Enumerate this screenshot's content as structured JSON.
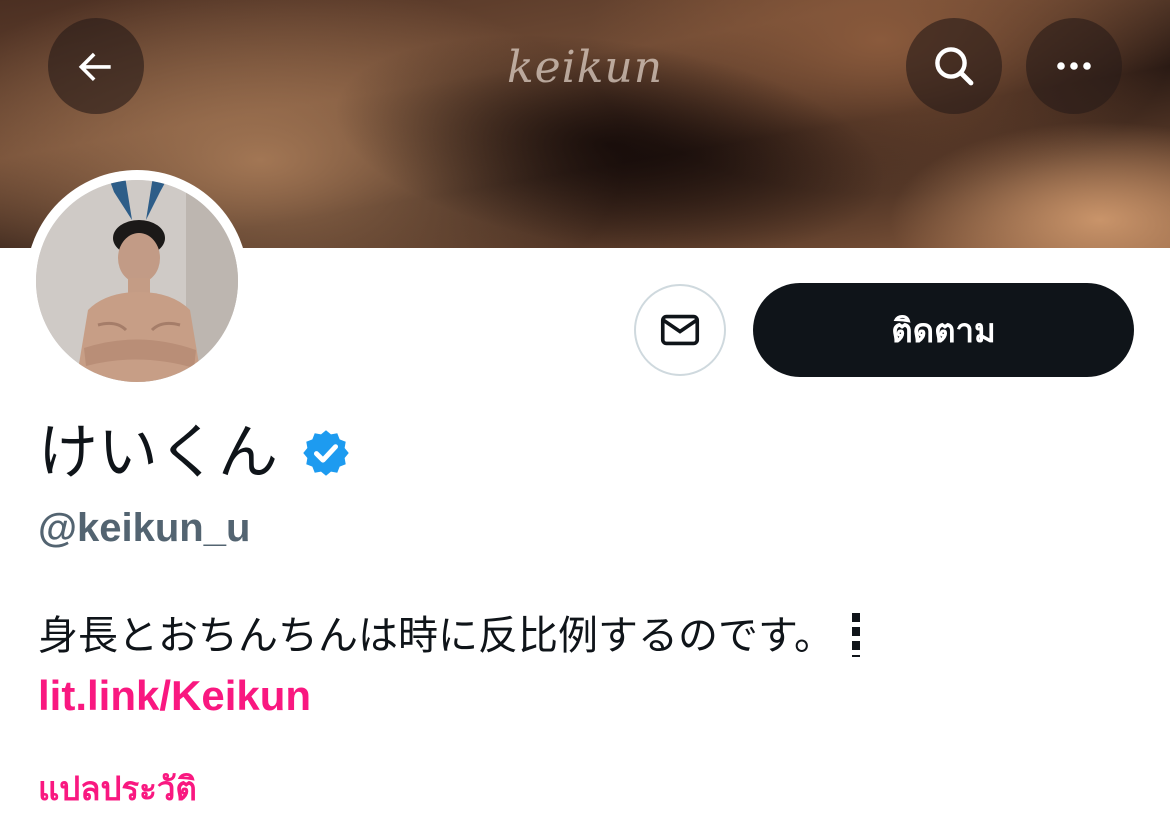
{
  "banner": {
    "wordmark": "keikun"
  },
  "header": {
    "back_icon": "arrow-left-icon",
    "search_icon": "search-icon",
    "more_icon": "more-horizontal-icon"
  },
  "profile": {
    "display_name": "けいくん",
    "handle": "@keikun_u",
    "bio": "身長とおちんちんは時に反比例するのです。",
    "link": "lit.link/Keikun",
    "translate_label": "แปลประวัติ",
    "verified_icon": "verified-badge-icon"
  },
  "actions": {
    "message_icon": "envelope-icon",
    "follow_label": "ติดตาม"
  },
  "colors": {
    "accent": "#f91880",
    "verified": "#1d9bf0",
    "follow_bg": "#0f1419",
    "secondary_text": "#536471"
  }
}
